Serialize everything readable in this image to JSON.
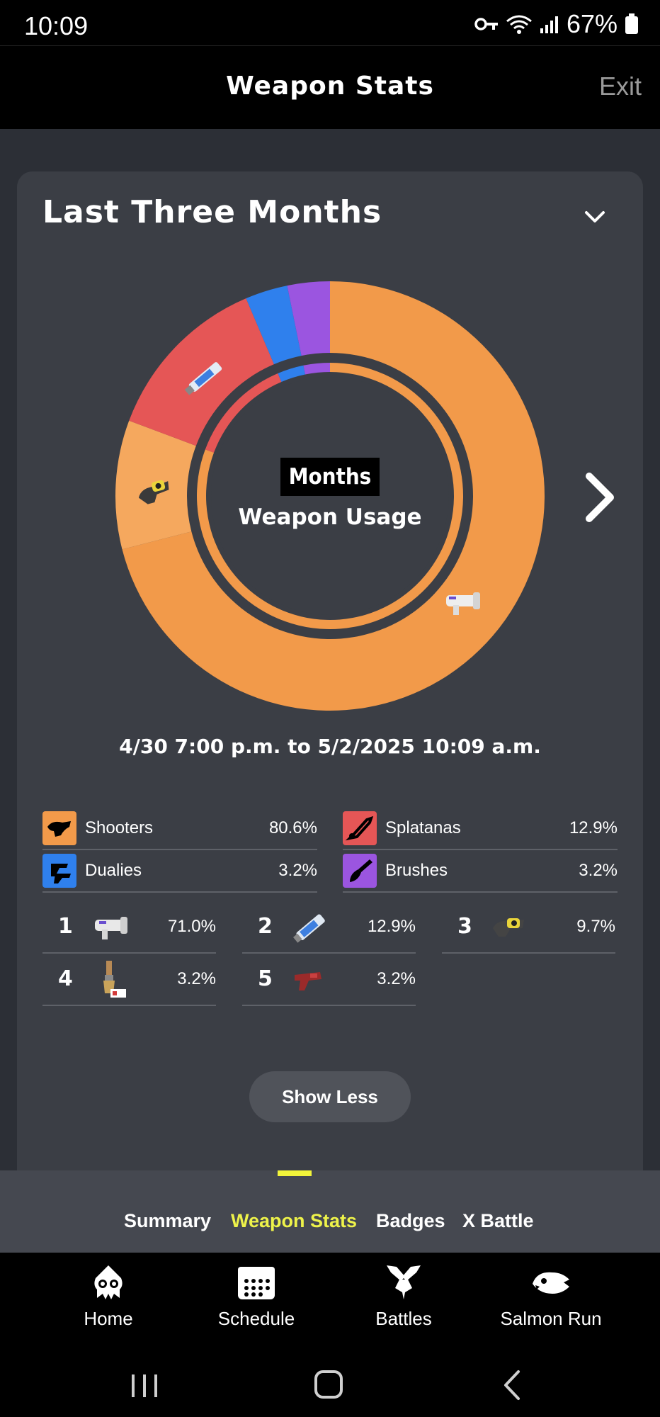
{
  "status": {
    "time": "10:09",
    "battery": "67%"
  },
  "header": {
    "title": "Weapon Stats",
    "exit": "Exit"
  },
  "card": {
    "title": "Last Three Months",
    "chart_center_label": "Months",
    "chart_center_sub": "Weapon Usage",
    "date_range": "4/30 7:00 p.m. to 5/2/2025 10:09 a.m."
  },
  "chart_data": {
    "type": "pie",
    "categories": [
      "Shooters",
      "Splatanas",
      "Dualies",
      "Brushes"
    ],
    "values": [
      80.6,
      12.9,
      3.2,
      3.2
    ],
    "outer_ring_segments": [
      {
        "category": "Shooters",
        "weapon_rank": 1,
        "value": 71.0,
        "color": "#f29a4a"
      },
      {
        "category": "Shooters",
        "weapon_rank": 3,
        "value": 9.7,
        "color": "#f5a85e"
      },
      {
        "category": "Splatanas",
        "weapon_rank": 2,
        "value": 12.9,
        "color": "#e55656"
      },
      {
        "category": "Dualies",
        "weapon_rank": 5,
        "value": 3.2,
        "color": "#2f80ed"
      },
      {
        "category": "Brushes",
        "weapon_rank": 4,
        "value": 3.2,
        "color": "#9b55e0"
      }
    ]
  },
  "legend": [
    {
      "name": "Shooters",
      "pct": "80.6%",
      "color": "#f29a4a",
      "icon": "shooter-icon"
    },
    {
      "name": "Splatanas",
      "pct": "12.9%",
      "color": "#e55656",
      "icon": "splatana-icon"
    },
    {
      "name": "Dualies",
      "pct": "3.2%",
      "color": "#2f80ed",
      "icon": "dualies-icon"
    },
    {
      "name": "Brushes",
      "pct": "3.2%",
      "color": "#9b55e0",
      "icon": "brush-icon"
    }
  ],
  "ranking": [
    {
      "rank": "1",
      "pct": "71.0%",
      "icon": "shooter-weapon-icon"
    },
    {
      "rank": "2",
      "pct": "12.9%",
      "icon": "splatana-weapon-icon"
    },
    {
      "rank": "3",
      "pct": "9.7%",
      "icon": "yellow-shooter-weapon-icon"
    },
    {
      "rank": "4",
      "pct": "3.2%",
      "icon": "brush-weapon-icon"
    },
    {
      "rank": "5",
      "pct": "3.2%",
      "icon": "dualies-weapon-icon"
    }
  ],
  "show_less": "Show Less",
  "tabs": [
    {
      "label": "Summary",
      "active": false
    },
    {
      "label": "Weapon Stats",
      "active": true
    },
    {
      "label": "Badges",
      "active": false
    },
    {
      "label": "X Battle",
      "active": false
    }
  ],
  "nav": [
    {
      "label": "Home",
      "icon": "squid-icon"
    },
    {
      "label": "Schedule",
      "icon": "calendar-icon"
    },
    {
      "label": "Battles",
      "icon": "crossed-weapons-icon"
    },
    {
      "label": "Salmon Run",
      "icon": "salmon-icon"
    }
  ],
  "colors": {
    "accent": "#eef34a",
    "card": "#3b3e45",
    "background": "#2c2f36"
  }
}
